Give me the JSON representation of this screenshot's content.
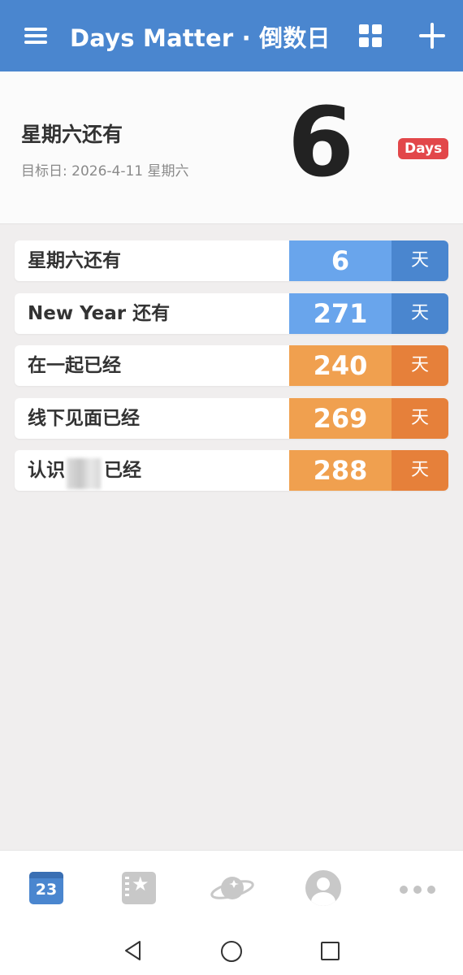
{
  "header": {
    "title": "Days Matter · 倒数日",
    "menu_icon": "hamburger-menu-icon",
    "grid_icon": "grid-icon",
    "add_icon": "plus-icon",
    "color": "#4a86cf"
  },
  "top_card": {
    "label": "星期六还有",
    "target": "目标日: 2026-4-11 星期六",
    "number": "6",
    "badge": "Days",
    "badge_color": "#e2474a"
  },
  "events": [
    {
      "label": "星期六还有",
      "count": "6",
      "unit": "天",
      "num_color": "#69a5ec",
      "unit_color": "#4a86cf"
    },
    {
      "label": "New Year 还有",
      "count": "271",
      "unit": "天",
      "num_color": "#69a5ec",
      "unit_color": "#4a86cf"
    },
    {
      "label": "在一起已经",
      "count": "240",
      "unit": "天",
      "num_color": "#f0a04f",
      "unit_color": "#e6803a"
    },
    {
      "label": "线下见面已经",
      "count": "269",
      "unit": "天",
      "num_color": "#f0a04f",
      "unit_color": "#e6803a"
    },
    {
      "label": "认识",
      "label_suffix": "已经",
      "count": "288",
      "unit": "天",
      "num_color": "#f0a04f",
      "unit_color": "#e6803a"
    }
  ],
  "bottom_nav": {
    "calendar_day": "23",
    "items": [
      "calendar-icon",
      "book-star-icon",
      "planet-icon",
      "profile-icon",
      "more-icon"
    ]
  },
  "system_nav": {
    "items": [
      "back-icon",
      "home-icon",
      "recent-apps-icon"
    ]
  }
}
